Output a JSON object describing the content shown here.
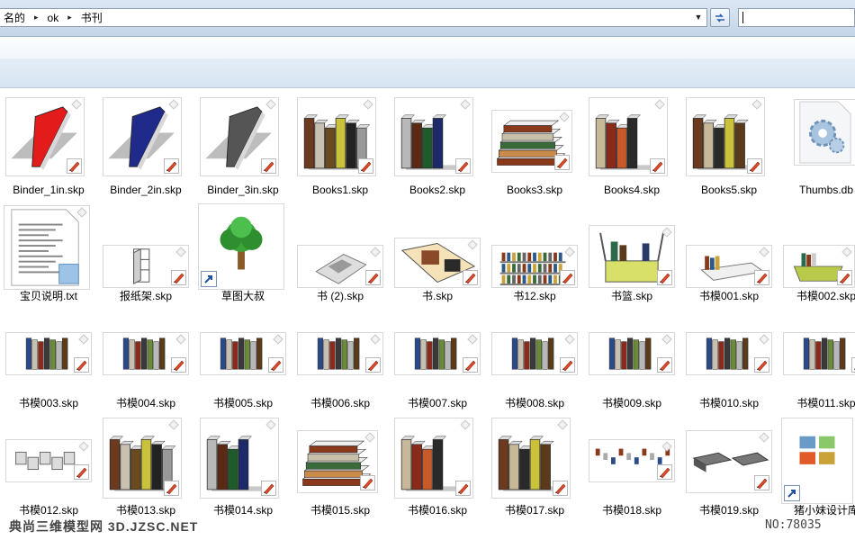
{
  "address": {
    "crumbs": [
      "名的",
      "ok",
      "书刊"
    ],
    "separator": "▸",
    "dropdown_glyph": "▼"
  },
  "search": {
    "value": ""
  },
  "files": [
    {
      "name": "Binder_1in.skp",
      "art": "binder",
      "color": "#e31b1b"
    },
    {
      "name": "Binder_2in.skp",
      "art": "binder",
      "color": "#1f2a8a"
    },
    {
      "name": "Binder_3in.skp",
      "art": "binder",
      "color": "#555555"
    },
    {
      "name": "Books1.skp",
      "art": "books-upright",
      "colors": [
        "#6b3a1f",
        "#c8c0b0",
        "#6a4a1f",
        "#c9c23a",
        "#222222",
        "#999999"
      ]
    },
    {
      "name": "Books2.skp",
      "art": "books-upright",
      "colors": [
        "#b8b8b8",
        "#5a2a14",
        "#1f5a2a",
        "#1c2a6a"
      ]
    },
    {
      "name": "Books3.skp",
      "art": "books-stack",
      "colors": [
        "#8a3a1a",
        "#c98a4a",
        "#3a6a3a",
        "#c8c0a8",
        "#8a3a1a"
      ]
    },
    {
      "name": "Books4.skp",
      "art": "books-upright",
      "colors": [
        "#c8b89a",
        "#8a2a1a",
        "#c85a2a",
        "#2a2a2a"
      ]
    },
    {
      "name": "Books5.skp",
      "art": "books-upright",
      "colors": [
        "#6b3a1f",
        "#c8b89a",
        "#2a2a2a",
        "#c9c23a",
        "#5a3a1a"
      ]
    },
    {
      "name": "Thumbs.db",
      "art": "gear"
    },
    {
      "name": "宝贝说明.txt",
      "art": "doc"
    },
    {
      "name": "报纸架.skp",
      "art": "rack"
    },
    {
      "name": "草图大叔",
      "art": "tree"
    },
    {
      "name": "书 (2).skp",
      "art": "mag-flat"
    },
    {
      "name": "书.skp",
      "art": "mag-open"
    },
    {
      "name": "书12.skp",
      "art": "shelves"
    },
    {
      "name": "书篮.skp",
      "art": "basket"
    },
    {
      "name": "书模001.skp",
      "art": "shelf-white"
    },
    {
      "name": "书模002.skp",
      "art": "basket2"
    },
    {
      "name": "书模003.skp",
      "art": "row"
    },
    {
      "name": "书模004.skp",
      "art": "row"
    },
    {
      "name": "书模005.skp",
      "art": "row"
    },
    {
      "name": "书模006.skp",
      "art": "row"
    },
    {
      "name": "书模007.skp",
      "art": "row"
    },
    {
      "name": "书模008.skp",
      "art": "row"
    },
    {
      "name": "书模009.skp",
      "art": "row"
    },
    {
      "name": "书模010.skp",
      "art": "row"
    },
    {
      "name": "书模011.skp",
      "art": "row"
    },
    {
      "name": "书模012.skp",
      "art": "cubes"
    },
    {
      "name": "书模013.skp",
      "art": "books-upright",
      "colors": [
        "#6b3a1f",
        "#c8c0b0",
        "#6a4a1f",
        "#c9c23a",
        "#222222",
        "#999999"
      ]
    },
    {
      "name": "书模014.skp",
      "art": "books-upright",
      "colors": [
        "#b8b8b8",
        "#5a2a14",
        "#1f5a2a",
        "#1c2a6a"
      ]
    },
    {
      "name": "书模015.skp",
      "art": "books-stack",
      "colors": [
        "#8a3a1a",
        "#c98a4a",
        "#3a6a3a",
        "#c8c0a8",
        "#8a3a1a"
      ]
    },
    {
      "name": "书模016.skp",
      "art": "books-upright",
      "colors": [
        "#c8b89a",
        "#8a2a1a",
        "#c85a2a",
        "#2a2a2a"
      ]
    },
    {
      "name": "书模017.skp",
      "art": "books-upright",
      "colors": [
        "#6b3a1f",
        "#c8b89a",
        "#2a2a2a",
        "#c9c23a",
        "#5a3a1a"
      ]
    },
    {
      "name": "书模018.skp",
      "art": "scatter"
    },
    {
      "name": "书模019.skp",
      "art": "flat-stacks"
    },
    {
      "name": "猪小妹设计库",
      "art": "images"
    }
  ],
  "watermark": {
    "left": "典尚三维模型网 3D.JZSC.NET",
    "right": "NO:78035"
  }
}
